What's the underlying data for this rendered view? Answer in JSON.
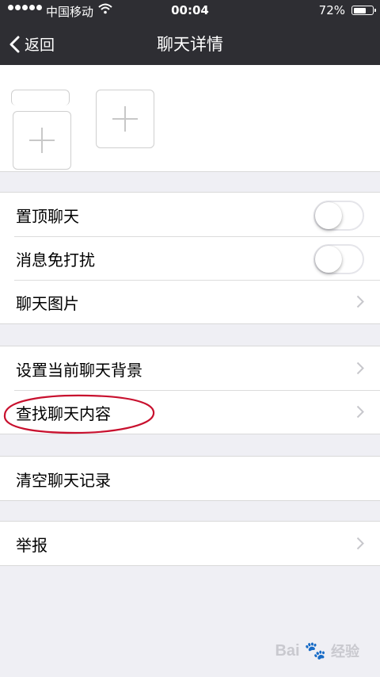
{
  "status_bar": {
    "carrier": "中国移动",
    "time": "00:04",
    "battery_percent": "72%",
    "battery_level": 0.72
  },
  "nav": {
    "back_label": "返回",
    "title": "聊天详情"
  },
  "members": {
    "add_icon": "plus-icon"
  },
  "settings": {
    "group1": [
      {
        "label": "置顶聊天",
        "type": "toggle",
        "value": false
      },
      {
        "label": "消息免打扰",
        "type": "toggle",
        "value": false
      },
      {
        "label": "聊天图片",
        "type": "link"
      }
    ],
    "group2": [
      {
        "label": "设置当前聊天背景",
        "type": "link"
      },
      {
        "label": "查找聊天内容",
        "type": "link"
      }
    ],
    "group3": [
      {
        "label": "清空聊天记录",
        "type": "action"
      }
    ],
    "group4": [
      {
        "label": "举报",
        "type": "link"
      }
    ]
  },
  "annotation": {
    "color": "#c8102e"
  },
  "watermark": {
    "brand": "Bai",
    "suffix": "经验"
  }
}
